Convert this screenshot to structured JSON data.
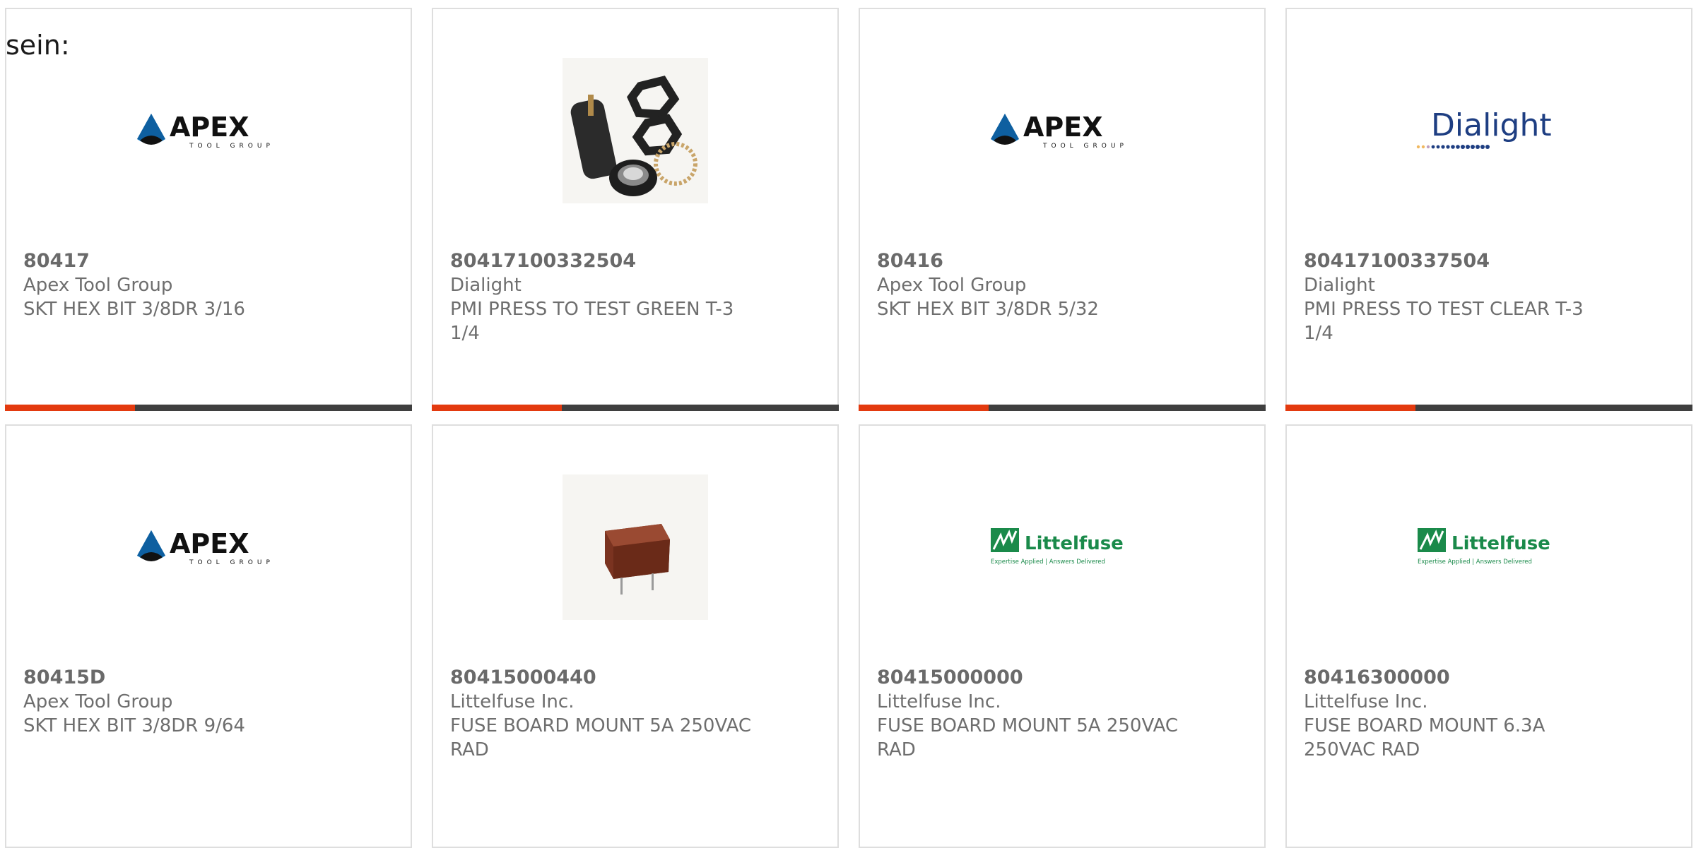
{
  "intro_text": "sein:",
  "colors": {
    "accent": "#e33a0f",
    "bar": "#3f3f3f",
    "border": "#dedede",
    "text": "#6e6e6e"
  },
  "products": [
    {
      "part": "80417",
      "brand": "Apex Tool Group",
      "desc": "SKT HEX BIT 3/8DR 3/16",
      "image": "apex-tool-group-logo"
    },
    {
      "part": "80417100332504",
      "brand": "Dialight",
      "desc": "PMI PRESS TO TEST GREEN T-3 1/4",
      "image": "press-to-test-lamp-photo"
    },
    {
      "part": "80416",
      "brand": "Apex Tool Group",
      "desc": "SKT HEX BIT 3/8DR 5/32",
      "image": "apex-tool-group-logo"
    },
    {
      "part": "80417100337504",
      "brand": "Dialight",
      "desc": "PMI PRESS TO TEST CLEAR T-3 1/4",
      "image": "dialight-logo"
    },
    {
      "part": "80415D",
      "brand": "Apex Tool Group",
      "desc": "SKT HEX BIT 3/8DR 9/64",
      "image": "apex-tool-group-logo"
    },
    {
      "part": "80415000440",
      "brand": "Littelfuse Inc.",
      "desc": "FUSE BOARD MOUNT 5A 250VAC RAD",
      "image": "fuse-photo"
    },
    {
      "part": "80415000000",
      "brand": "Littelfuse Inc.",
      "desc": "FUSE BOARD MOUNT 5A 250VAC RAD",
      "image": "littelfuse-logo"
    },
    {
      "part": "80416300000",
      "brand": "Littelfuse Inc.",
      "desc": "FUSE BOARD MOUNT 6.3A 250VAC RAD",
      "image": "littelfuse-logo"
    }
  ],
  "logos": {
    "apex": {
      "word": "APEX",
      "sub": "TOOL GROUP"
    },
    "dialight": {
      "word": "Dialight"
    },
    "littelfuse": {
      "word": "Littelfuse",
      "tagline": "Expertise Applied | Answers Delivered"
    }
  }
}
